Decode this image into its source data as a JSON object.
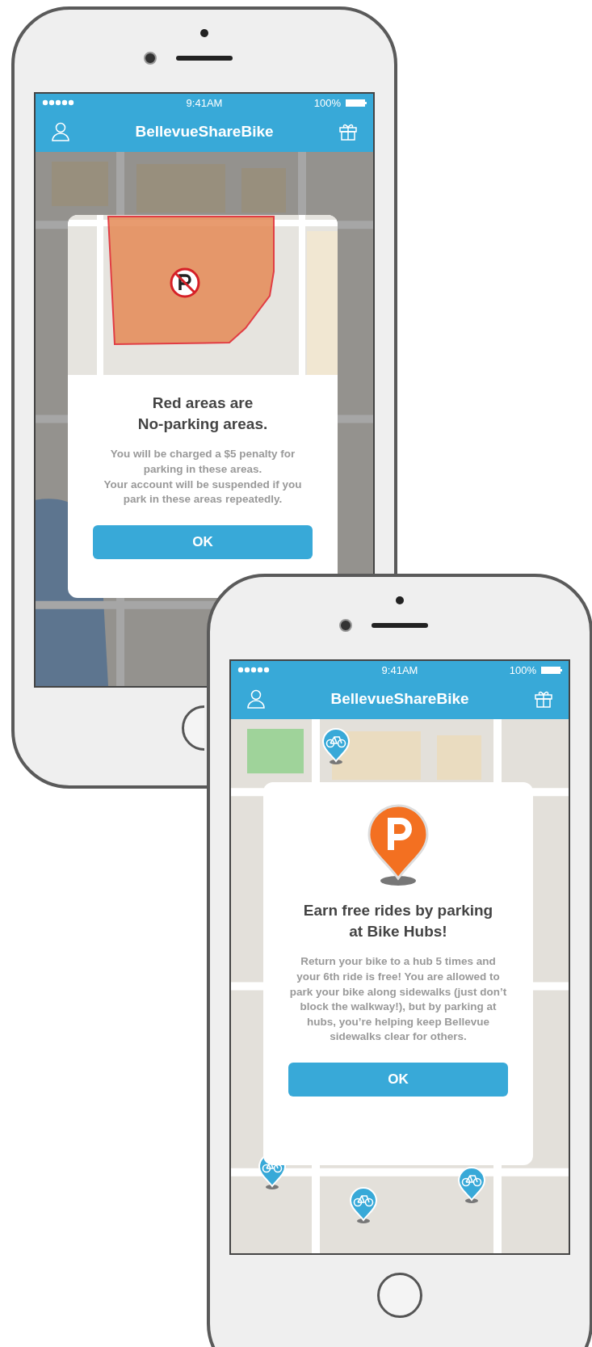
{
  "phones": [
    {
      "status_bar": {
        "time": "9:41AM",
        "battery": "100%"
      },
      "nav_bar": {
        "title": "BellevueShareBike"
      },
      "dialog": {
        "kind": "no_parking_map",
        "heading": "Red areas are\nNo-parking areas.",
        "body": "You will be charged a $5 penalty for\nparking in these areas.\nYour account will be suspended if you\npark in these areas repeatedly.",
        "button": "OK"
      }
    },
    {
      "status_bar": {
        "time": "9:41AM",
        "battery": "100%"
      },
      "nav_bar": {
        "title": "BellevueShareBike"
      },
      "dialog": {
        "kind": "parking_pin",
        "heading": "Earn free rides by parking\nat Bike Hubs!",
        "body": "Return your bike to a hub 5 times and\nyour 6th ride is free! You are allowed to\npark your bike along sidewalks (just don’t\nblock the walkway!), but by parking at\nhubs, you’re helping keep Bellevue\nsidewalks clear for others.",
        "button": "OK"
      }
    }
  ]
}
